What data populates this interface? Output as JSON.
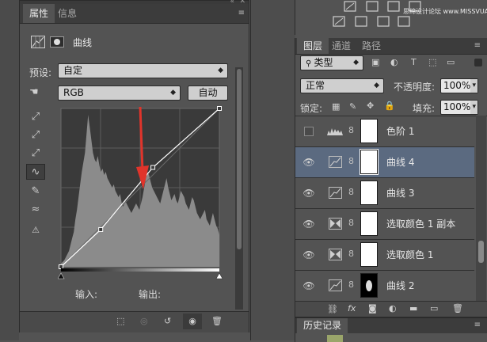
{
  "properties": {
    "tabs": [
      "属性",
      "信息"
    ],
    "panel_title": "曲线",
    "preset_label": "预设:",
    "preset_value": "自定",
    "channel_value": "RGB",
    "auto_button": "自动",
    "input_label": "输入:",
    "output_label": "输出:",
    "header_controls": "«",
    "close_glyph": "✕",
    "menu_glyph": "≡"
  },
  "top_strip": {
    "watermark": "思绵设计论坛 www.MISSVUAN.com"
  },
  "layers_panel": {
    "tabs": [
      "图层",
      "通道",
      "路径"
    ],
    "filter_kind": "类型",
    "blend_mode": "正常",
    "opacity_label": "不透明度:",
    "opacity_value": "100%",
    "lock_label": "锁定:",
    "fill_label": "填充:",
    "fill_value": "100%",
    "layers": [
      {
        "name": "色阶 1",
        "type": "levels",
        "visible": false,
        "selected": false
      },
      {
        "name": "曲线 4",
        "type": "curves",
        "visible": true,
        "selected": true
      },
      {
        "name": "曲线 3",
        "type": "curves",
        "visible": true,
        "selected": false
      },
      {
        "name": "选取颜色 1 副本",
        "type": "selective-color",
        "visible": true,
        "selected": false
      },
      {
        "name": "选取颜色 1",
        "type": "selective-color",
        "visible": true,
        "selected": false
      },
      {
        "name": "曲线 2",
        "type": "curves",
        "visible": true,
        "selected": false
      }
    ],
    "footer_icons": [
      "link-icon",
      "fx-icon",
      "add-mask-icon",
      "adjustment-icon",
      "group-icon",
      "new-layer-icon",
      "trash-icon"
    ]
  },
  "history_panel": {
    "tab": "历史记录"
  },
  "colors": {
    "selected_row": "#5b6a80",
    "arrow": "#e0342b",
    "curve": "#ffffff",
    "histogram": "#8b8b8b"
  },
  "curve": {
    "points": [
      [
        0,
        0
      ],
      [
        64,
        60
      ],
      [
        148,
        160
      ],
      [
        255,
        255
      ]
    ],
    "histogram": [
      2,
      3,
      4,
      6,
      8,
      10,
      14,
      18,
      22,
      30,
      36,
      44,
      52,
      60,
      66,
      72,
      84,
      96,
      88,
      80,
      72,
      68,
      66,
      70,
      64,
      60,
      62,
      58,
      60,
      56,
      54,
      52,
      50,
      52,
      48,
      46,
      44,
      46,
      40,
      38,
      42,
      40,
      38,
      36,
      34,
      36,
      38,
      40,
      38,
      36,
      40,
      44,
      50,
      56,
      60,
      58,
      54,
      50,
      48,
      46,
      44,
      42,
      40,
      44,
      48,
      52,
      56,
      50,
      46,
      42,
      44,
      46,
      42,
      40,
      44,
      48,
      46,
      44,
      40,
      38,
      36,
      40,
      44,
      42,
      38,
      34,
      32,
      30,
      32,
      34,
      36,
      30,
      28,
      26,
      30,
      34,
      30,
      26,
      24,
      20
    ]
  }
}
